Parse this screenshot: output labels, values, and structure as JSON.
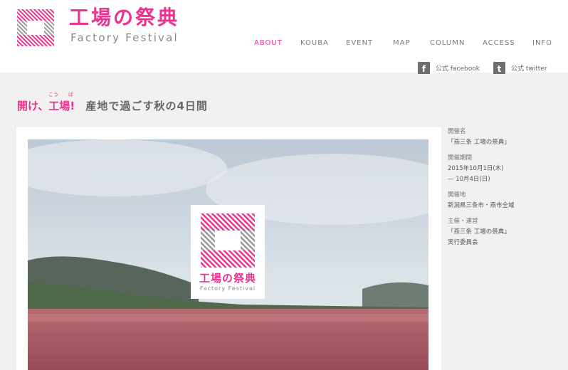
{
  "header": {
    "logo_jp": "工場の祭典",
    "logo_en": "Factory Festival",
    "nav": [
      {
        "label": "ABOUT",
        "active": true
      },
      {
        "label": "KOUBA",
        "active": false
      },
      {
        "label": "EVENT",
        "active": false
      },
      {
        "label": "MAP",
        "active": false
      },
      {
        "label": "COLUMN",
        "active": false
      },
      {
        "label": "ACCESS",
        "active": false
      },
      {
        "label": "INFO",
        "active": false
      }
    ],
    "social": {
      "facebook_label": "公式 facebook",
      "twitter_label": "公式 twitter",
      "facebook_icon": "f",
      "twitter_icon": "t"
    }
  },
  "headline": {
    "pink_text": "開け、工場!",
    "ruby_kou": "こう",
    "ruby_ba": "ば",
    "gray_text": "産地で過ごす秋の4日間"
  },
  "badge": {
    "jp": "工場の祭典",
    "en": "Factory Festival"
  },
  "info": {
    "name_label": "開催名",
    "name_value": "「燕三条 工場の祭典」",
    "period_label": "開催期間",
    "period_line1": "2015年10月1日(木)",
    "period_line2": "— 10月4日(日)",
    "place_label": "開催地",
    "place_value": "新潟県三条市・燕市全域",
    "org_label": "主催・運営",
    "org_line1": "「燕三条 工場の祭典」",
    "org_line2": "実行委員会"
  },
  "colors": {
    "accent": "#e8358f",
    "text_gray": "#666666",
    "background": "#f1f1f1"
  }
}
